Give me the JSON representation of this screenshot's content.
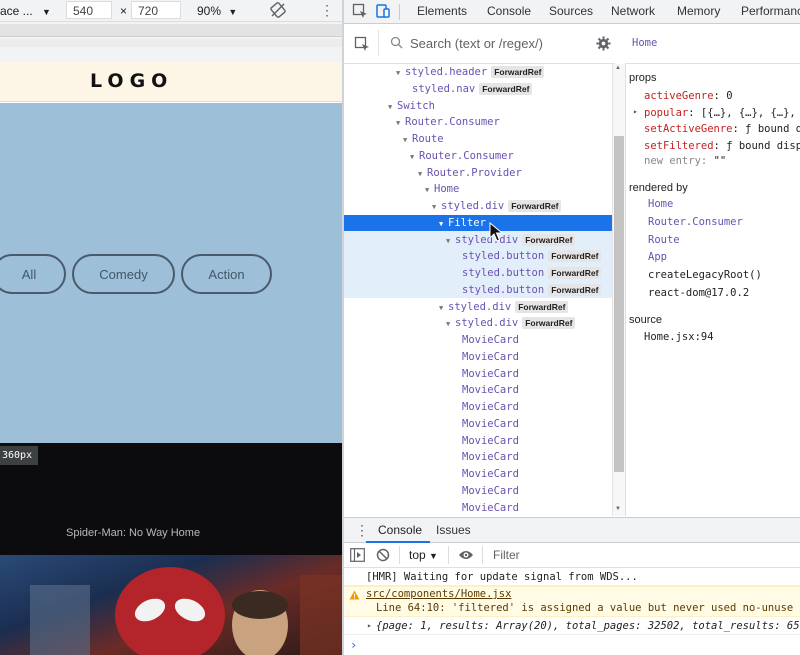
{
  "device": {
    "name": "ace ...",
    "width": "540",
    "times": "×",
    "height": "720",
    "zoom": "90%"
  },
  "page": {
    "logo": "LOGO",
    "genres": [
      "All",
      "Comedy",
      "Action"
    ],
    "size_badge": "360px",
    "movie_title": "Spider-Man: No Way Home"
  },
  "devtools": {
    "tabs": [
      "Elements",
      "Console",
      "Sources",
      "Network",
      "Memory",
      "Performanc"
    ],
    "search_placeholder": "Search (text or /regex/)",
    "selected_component": "Home"
  },
  "tree": [
    {
      "label": "styled.header",
      "badge": "ForwardRef",
      "tri": "▼"
    },
    {
      "label": "styled.nav",
      "badge": "ForwardRef",
      "tri": ""
    },
    {
      "label": "Switch",
      "badge": "",
      "tri": "▼"
    },
    {
      "label": "Router.Consumer",
      "badge": "",
      "tri": "▼"
    },
    {
      "label": "Route",
      "badge": "",
      "tri": "▼"
    },
    {
      "label": "Router.Consumer",
      "badge": "",
      "tri": "▼"
    },
    {
      "label": "Router.Provider",
      "badge": "",
      "tri": "▼"
    },
    {
      "label": "Home",
      "badge": "",
      "tri": "▼"
    },
    {
      "label": "styled.div",
      "badge": "ForwardRef",
      "tri": "▼"
    },
    {
      "label": "Filter",
      "badge": "",
      "tri": "▼"
    },
    {
      "label": "styled.div",
      "badge": "ForwardRef",
      "tri": "▼"
    },
    {
      "label": "styled.button",
      "badge": "ForwardRef",
      "tri": ""
    },
    {
      "label": "styled.button",
      "badge": "ForwardRef",
      "tri": ""
    },
    {
      "label": "styled.button",
      "badge": "ForwardRef",
      "tri": ""
    },
    {
      "label": "styled.div",
      "badge": "ForwardRef",
      "tri": "▼"
    },
    {
      "label": "styled.div",
      "badge": "ForwardRef",
      "tri": "▼"
    },
    {
      "label": "MovieCard",
      "badge": "",
      "tri": ""
    },
    {
      "label": "MovieCard",
      "badge": "",
      "tri": ""
    },
    {
      "label": "MovieCard",
      "badge": "",
      "tri": ""
    },
    {
      "label": "MovieCard",
      "badge": "",
      "tri": ""
    },
    {
      "label": "MovieCard",
      "badge": "",
      "tri": ""
    },
    {
      "label": "MovieCard",
      "badge": "",
      "tri": ""
    },
    {
      "label": "MovieCard",
      "badge": "",
      "tri": ""
    },
    {
      "label": "MovieCard",
      "badge": "",
      "tri": ""
    },
    {
      "label": "MovieCard",
      "badge": "",
      "tri": ""
    },
    {
      "label": "MovieCard",
      "badge": "",
      "tri": ""
    },
    {
      "label": "MovieCard",
      "badge": "",
      "tri": ""
    }
  ],
  "props_panel": {
    "props_title": "props",
    "props": [
      {
        "key": "activeGenre",
        "value": "0",
        "arrow": ""
      },
      {
        "key": "popular",
        "value": "[{…}, {…}, {…},",
        "arrow": "▸"
      },
      {
        "key": "setActiveGenre",
        "value": "ƒ bound d",
        "arrow": ""
      },
      {
        "key": "setFiltered",
        "value": "ƒ bound disp",
        "arrow": ""
      }
    ],
    "new_entry_key": "new entry",
    "new_entry_value": "\"\"",
    "rendered_by_title": "rendered by",
    "rendered_by": [
      "Home",
      "Router.Consumer",
      "Route",
      "App",
      "createLegacyRoot()",
      "react-dom@17.0.2"
    ],
    "source_title": "source",
    "source": "Home.jsx:94"
  },
  "console": {
    "tabs": [
      "Console",
      "Issues"
    ],
    "context": "top",
    "filter_placeholder": "Filter",
    "hmr": "[HMR] Waiting for update signal from WDS...",
    "warn_file": "src/components/Home.jsx",
    "warn_msg": "Line 64:10:  'filtered' is assigned a value but never used  no-unuse",
    "log_obj": "{page: 1, results: Array(20), total_pages: 32502, total_results: 65001"
  },
  "colors": {
    "selected": "#1a73e8",
    "highlight": "#e2effa",
    "component": "#6a51b2",
    "prop_key": "#c5221f"
  }
}
